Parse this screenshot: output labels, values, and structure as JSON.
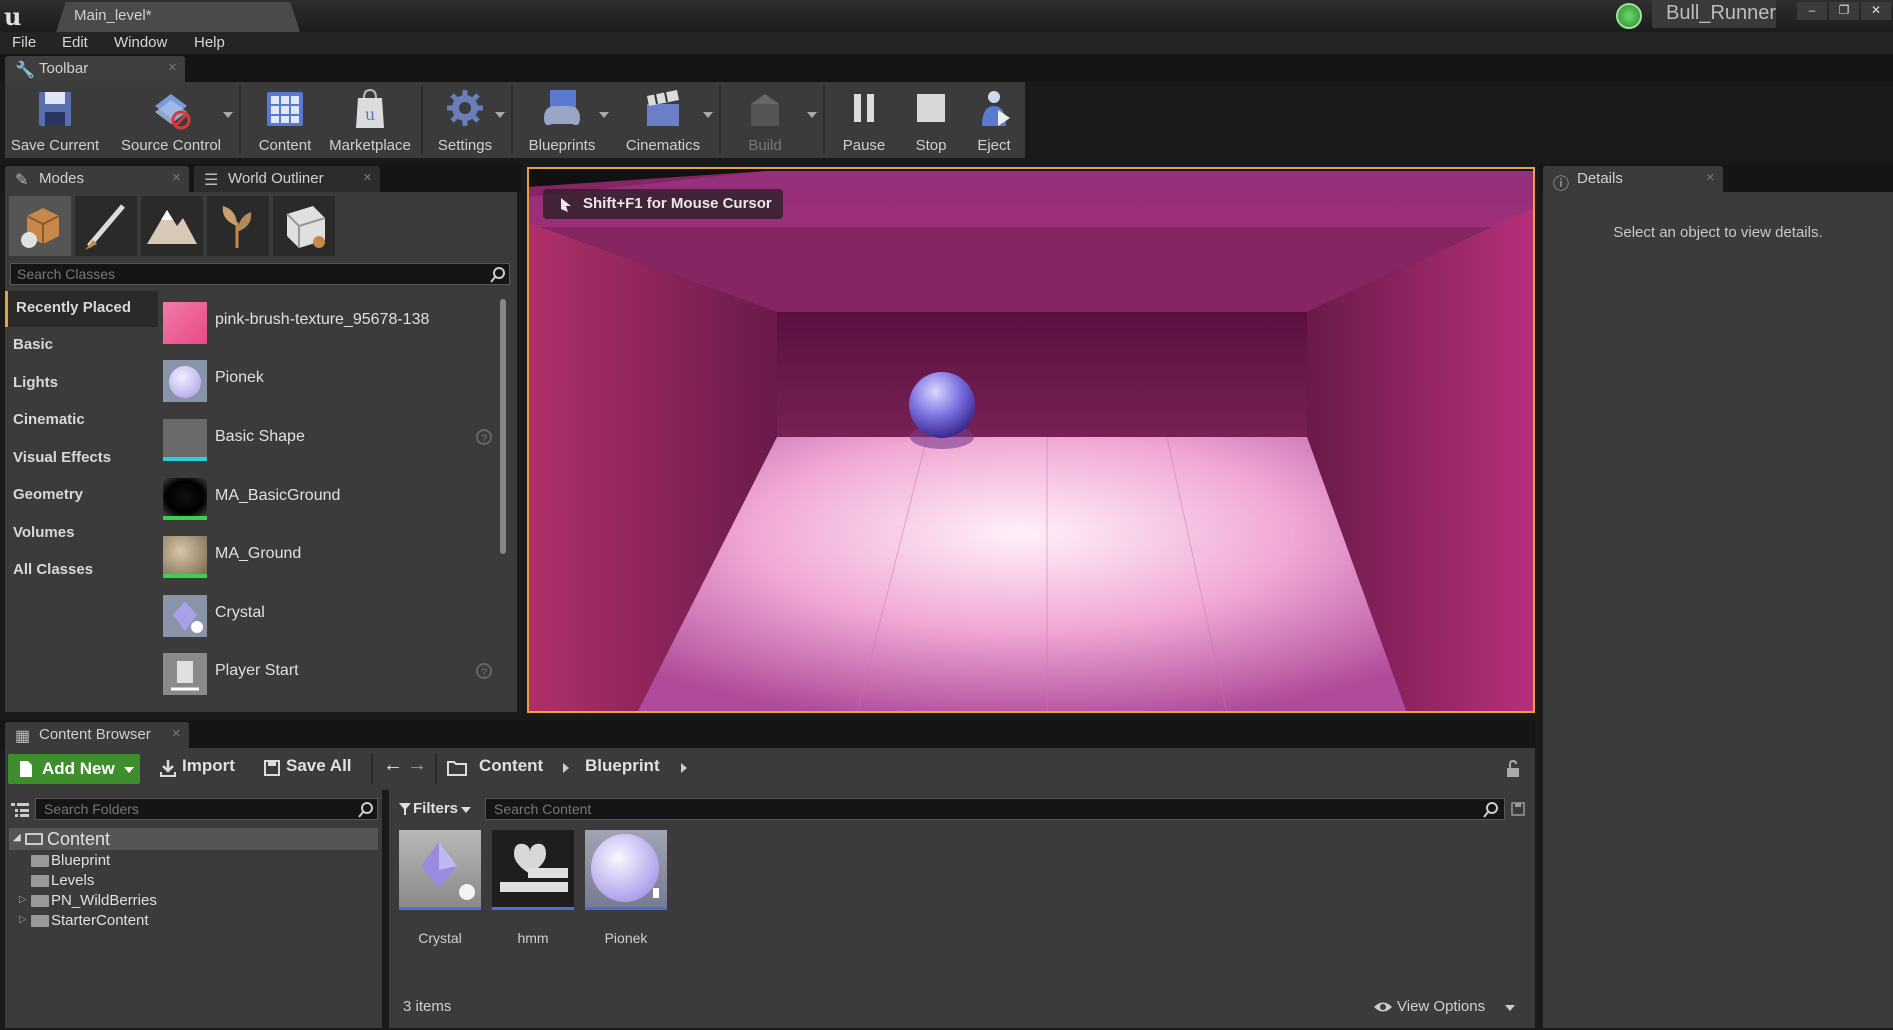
{
  "titlebar": {
    "level_tab": "Main_level*",
    "project": "Bull_Runner",
    "min": "–",
    "max": "❐",
    "close": "✕"
  },
  "menu": [
    "File",
    "Edit",
    "Window",
    "Help"
  ],
  "toolbar_tab": "Toolbar",
  "toolbar": {
    "save_current": "Save Current",
    "source_control": "Source Control",
    "content": "Content",
    "marketplace": "Marketplace",
    "settings": "Settings",
    "blueprints": "Blueprints",
    "cinematics": "Cinematics",
    "build": "Build",
    "pause": "Pause",
    "stop": "Stop",
    "eject": "Eject"
  },
  "modes": {
    "tab_modes": "Modes",
    "tab_outliner": "World Outliner",
    "search_placeholder": "Search Classes",
    "categories": [
      "Recently Placed",
      "Basic",
      "Lights",
      "Cinematic",
      "Visual Effects",
      "Geometry",
      "Volumes",
      "All Classes"
    ],
    "placed_items": [
      "pink-brush-texture_95678-138",
      "Pionek",
      "Basic Shape",
      "MA_BasicGround",
      "MA_Ground",
      "Crystal",
      "Player Start"
    ]
  },
  "viewport": {
    "hint": "Shift+F1 for Mouse Cursor"
  },
  "details": {
    "tab": "Details",
    "message": "Select an object to view details."
  },
  "content_browser": {
    "tab": "Content Browser",
    "add_new": "Add New",
    "import": "Import",
    "save_all": "Save All",
    "breadcrumb": [
      "Content",
      "Blueprint"
    ],
    "search_folders": "Search Folders",
    "filters": "Filters",
    "search_content": "Search Content",
    "tree_root": "Content",
    "tree_children": [
      "Blueprint",
      "Levels",
      "PN_WildBerries",
      "StarterContent"
    ],
    "assets": [
      "Crystal",
      "hmm",
      "Pionek"
    ],
    "item_count": "3 items",
    "view_options": "View Options"
  }
}
